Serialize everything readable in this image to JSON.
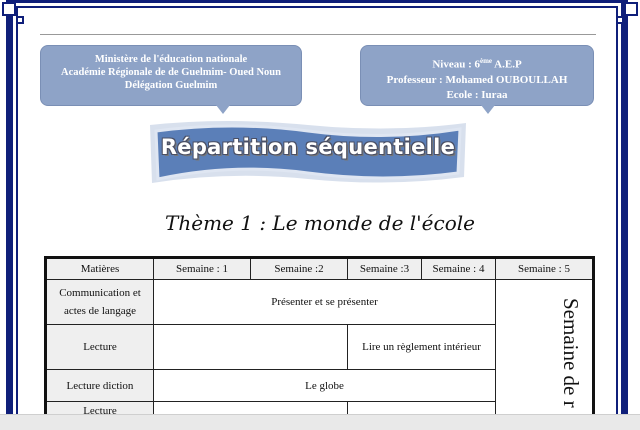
{
  "header_left": {
    "line1": "Ministère de l'éducation nationale",
    "line2": "Académie Régionale de de Guelmim- Oued Noun",
    "line3": "Délégation Guelmim"
  },
  "header_right": {
    "niveau_label": "Niveau : 6",
    "niveau_sup": "ème",
    "niveau_rest": " A.E.P",
    "professeur": "Professeur : Mohamed OUBOULLAH",
    "ecole": "Ecole : Iuraa"
  },
  "banner": {
    "title": "Répartition séquentielle"
  },
  "theme": {
    "title": "Thème 1 : Le monde de l'école"
  },
  "table": {
    "headers": [
      "Matières",
      "Semaine : 1",
      "Semaine :2",
      "Semaine :3",
      "Semaine : 4",
      "Semaine : 5"
    ],
    "rows": [
      {
        "subject": "Communication et actes de langage",
        "content": "Présenter et se présenter"
      },
      {
        "subject": "Lecture",
        "content": "Lire un règlement intérieur"
      },
      {
        "subject": "Lecture diction",
        "content": "Le globe"
      },
      {
        "subject": "Lecture",
        "content": ""
      }
    ],
    "week5_text": "Semaine de r"
  },
  "colors": {
    "frame": "#0f1f7a",
    "callout": "#8ea3c7",
    "banner": "#5b7fb8"
  }
}
